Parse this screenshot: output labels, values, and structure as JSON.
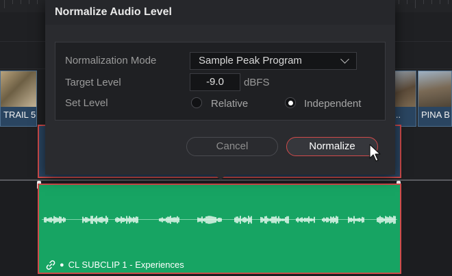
{
  "dialog": {
    "title": "Normalize Audio Level",
    "normalization_mode_label": "Normalization Mode",
    "normalization_mode_value": "Sample Peak Program",
    "target_level_label": "Target Level",
    "target_level_value": "-9.0",
    "target_level_unit": "dBFS",
    "set_level_label": "Set Level",
    "set_level_options": [
      "Relative",
      "Independent"
    ],
    "set_level_selected": "Independent",
    "cancel_label": "Cancel",
    "normalize_label": "Normalize"
  },
  "timeline": {
    "video_clips": [
      {
        "label": "TRAIL 5"
      },
      {
        "label": "L..."
      },
      {
        "label": "PINA B"
      }
    ],
    "audio_clip_label": "CL SUBCLIP 1 - Experiences"
  },
  "colors": {
    "audio_clip": "#17a463",
    "selection_border": "#d24b4b",
    "video_clip": "#2a4561"
  }
}
